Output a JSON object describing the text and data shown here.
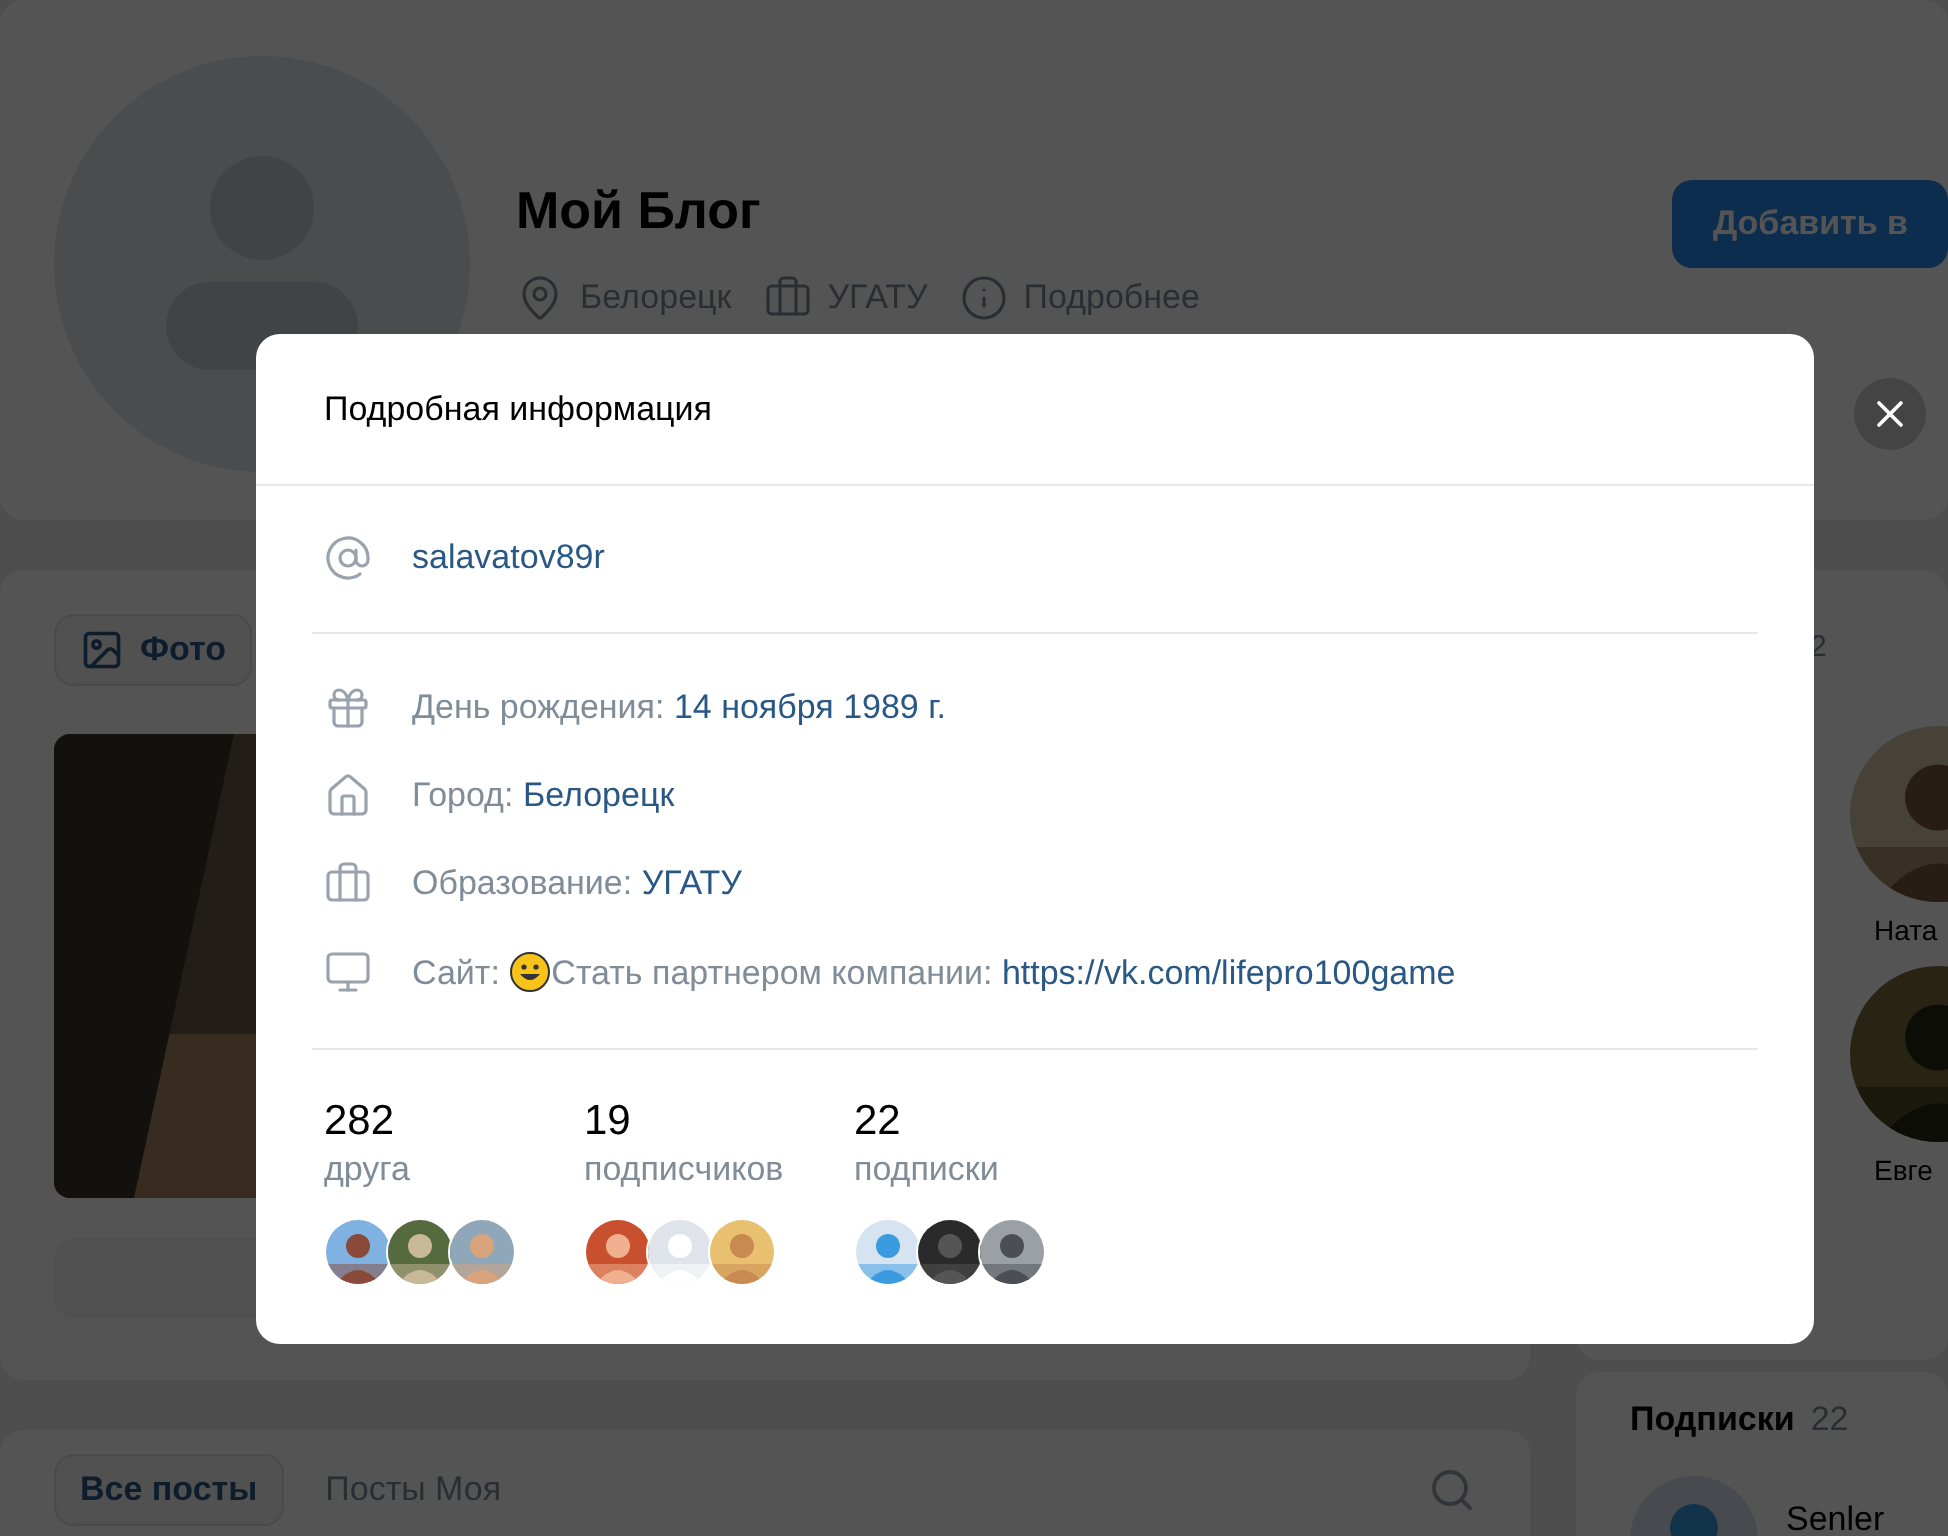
{
  "profile": {
    "name": "Мой Блог",
    "meta": [
      {
        "kind": "location",
        "text": "Белорецк"
      },
      {
        "kind": "education",
        "text": "УГАТУ"
      },
      {
        "kind": "info",
        "text": "Подробнее"
      }
    ],
    "action_button": "Добавить в"
  },
  "photos_card": {
    "tab": "Фото"
  },
  "friends_card": {
    "count_fragment": "2",
    "friends": [
      {
        "name": "Ната"
      },
      {
        "name": "Евге"
      }
    ]
  },
  "subscriptions_card": {
    "title": "Подписки",
    "count": "22",
    "items": [
      {
        "name": "Senler"
      }
    ]
  },
  "posts_card": {
    "tabs": [
      {
        "label": "Все посты",
        "selected": true
      },
      {
        "label": "Посты Моя",
        "selected": false
      }
    ]
  },
  "modal": {
    "title": "Подробная информация",
    "username": "salavatov89r",
    "details": [
      {
        "kind": "birthday",
        "label": "День рождения:",
        "value": "14 ноября 1989 г."
      },
      {
        "kind": "city",
        "label": "Город:",
        "value": "Белорецк"
      },
      {
        "kind": "education",
        "label": "Образование:",
        "value": "УГАТУ"
      },
      {
        "kind": "site",
        "label": "Сайт:",
        "note": "Стать партнером компании:",
        "value": "https://vk.com/lifepro100game"
      }
    ],
    "stats": [
      {
        "count": "282",
        "label": "друга"
      },
      {
        "count": "19",
        "label": "подписчиков"
      },
      {
        "count": "22",
        "label": "подписки"
      }
    ]
  }
}
